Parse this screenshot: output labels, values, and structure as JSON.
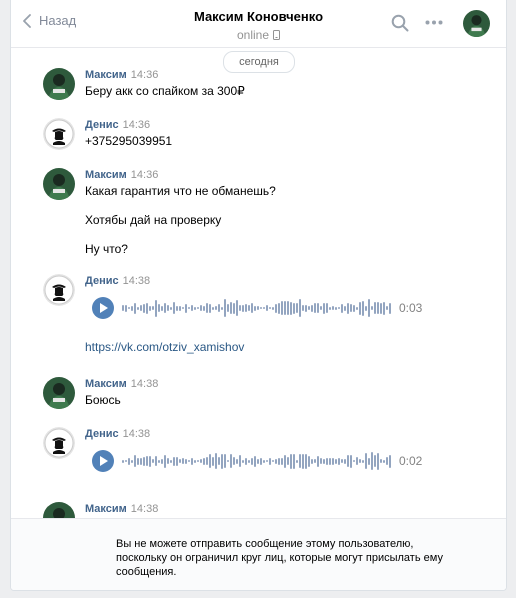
{
  "header": {
    "back_label": "Назад",
    "name": "Максим Коновченко",
    "status": "online"
  },
  "date_divider": "сегодня",
  "messages": [
    {
      "author": "Максим",
      "time": "14:36",
      "avatar": "maksim",
      "text": [
        "Беру акк со спайком за 300₽"
      ]
    },
    {
      "author": "Денис",
      "time": "14:36",
      "avatar": "denis",
      "text": [
        "+375295039951"
      ]
    },
    {
      "author": "Максим",
      "time": "14:36",
      "avatar": "maksim",
      "text": [
        "Какая гарантия что не обманешь?",
        "Хотябы дай на проверку",
        "Ну что?"
      ]
    },
    {
      "author": "Денис",
      "time": "14:38",
      "avatar": "denis",
      "audio_duration": "0:03",
      "link": "https://vk.com/otziv_xamishov"
    },
    {
      "author": "Максим",
      "time": "14:38",
      "avatar": "maksim",
      "text": [
        "Боюсь"
      ]
    },
    {
      "author": "Денис",
      "time": "14:38",
      "avatar": "denis",
      "audio_duration": "0:02"
    },
    {
      "author": "Максим",
      "time": "14:38",
      "avatar": "maksim"
    }
  ],
  "footer": {
    "notice": "Вы не можете отправить сообщение этому пользователю, поскольку он ограничил круг лиц, которые могут присылать ему сообщения."
  },
  "icons": {
    "back": "chevron-left-icon",
    "search": "search-icon",
    "more": "more-dots-icon",
    "phone": "mobile-phone-icon",
    "play": "play-icon"
  },
  "colors": {
    "author": "#42648b",
    "link": "#2a5885",
    "play_button": "#5181b8",
    "waveform": "#93a5c0"
  }
}
